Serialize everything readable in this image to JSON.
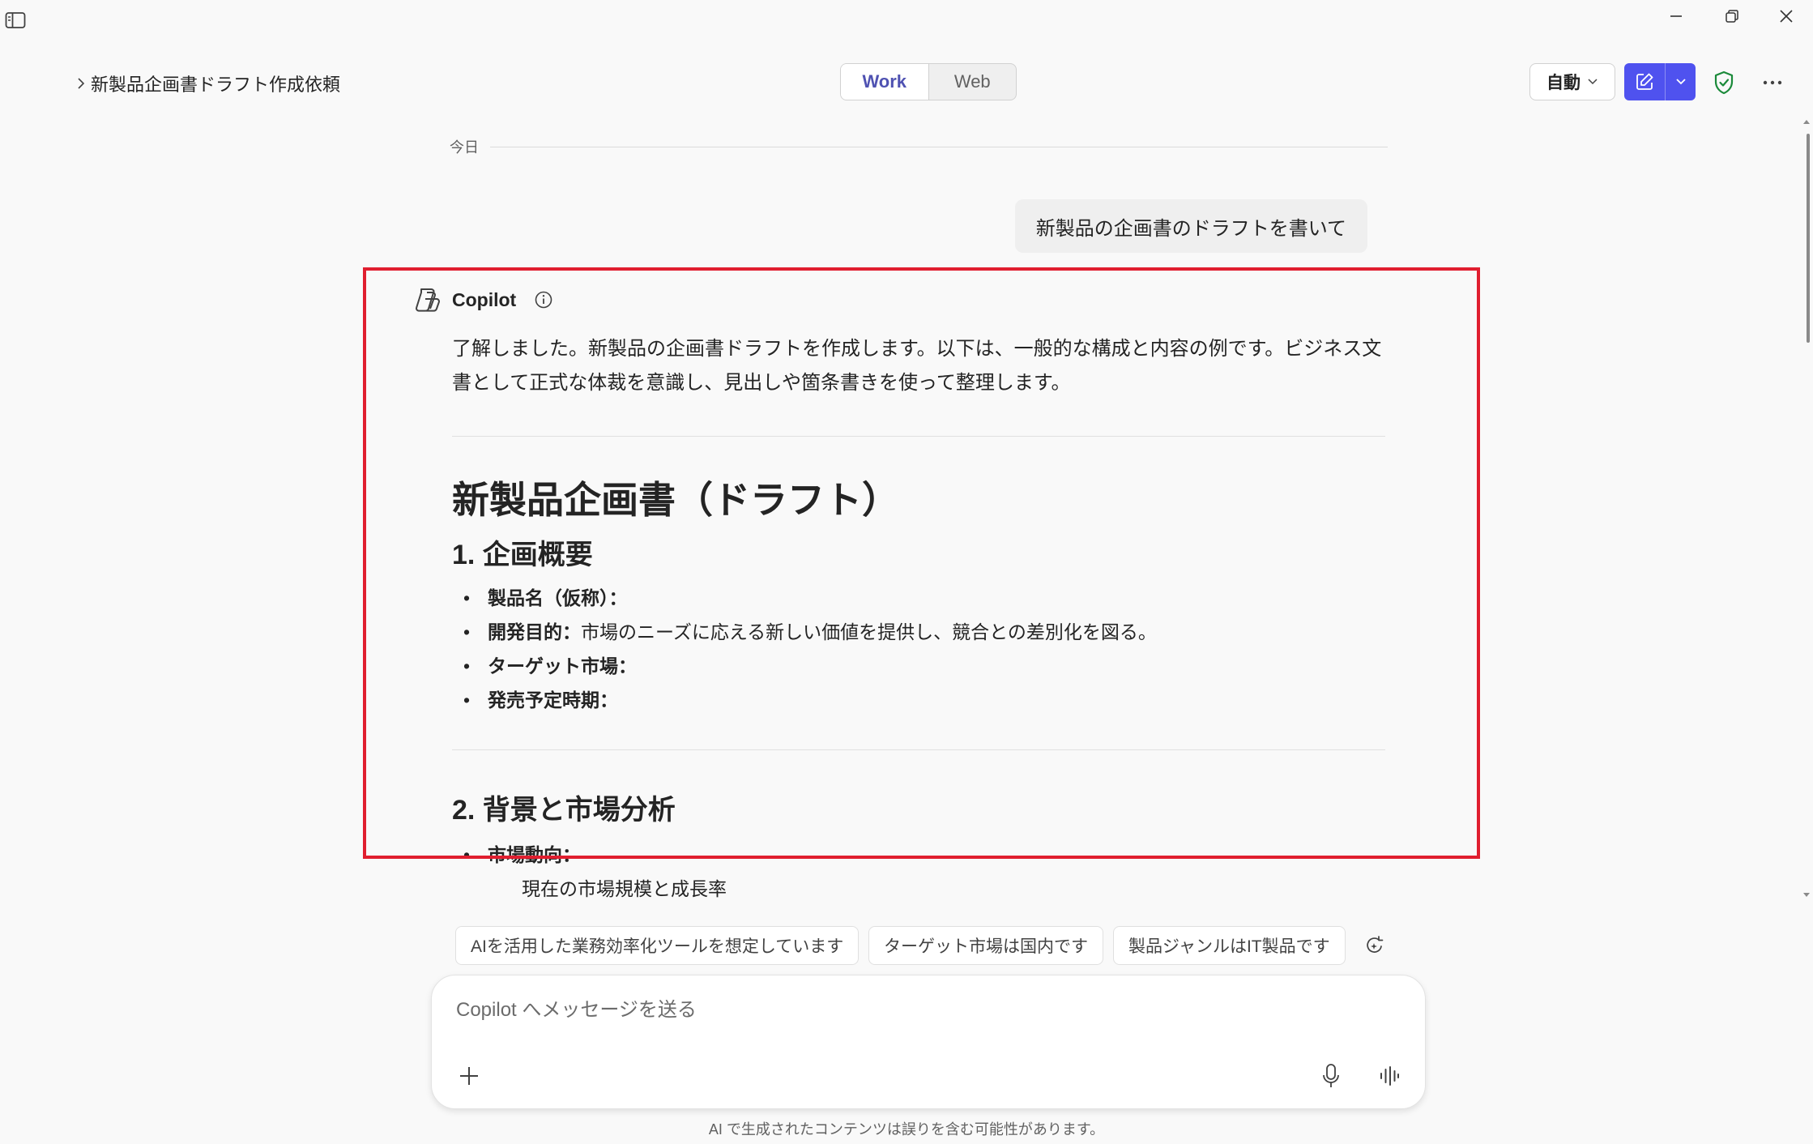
{
  "window": {
    "sidebar_icon": "sidebar-toggle-icon",
    "minimize_icon": "minimize-icon",
    "restore_icon": "restore-icon",
    "close_icon": "close-icon"
  },
  "header": {
    "breadcrumb_title": "新製品企画書ドラフト作成依頼",
    "toggle": {
      "work": "Work",
      "web": "Web"
    },
    "mode_label": "自動",
    "accent_color": "#4f52ef",
    "shield_color": "#1b8a3a"
  },
  "chat": {
    "date_label": "今日",
    "user_message": "新製品の企画書のドラフトを書いて",
    "assistant_name": "Copilot",
    "intro": "了解しました。新製品の企画書ドラフトを作成します。以下は、一般的な構成と内容の例です。ビジネス文書として正式な体裁を意識し、見出しや箇条書きを使って整理します。",
    "doc_title": "新製品企画書（ドラフト）",
    "section1": {
      "heading": "1. 企画概要",
      "items": [
        {
          "label": "製品名（仮称）：",
          "text": ""
        },
        {
          "label": "開発目的：",
          "text": "市場のニーズに応える新しい価値を提供し、競合との差別化を図る。"
        },
        {
          "label": "ターゲット市場：",
          "text": ""
        },
        {
          "label": "発売予定時期：",
          "text": ""
        }
      ]
    },
    "section2": {
      "heading": "2. 背景と市場分析",
      "items": [
        {
          "label": "市場動向：",
          "text": ""
        }
      ],
      "sub_item": "現在の市場規模と成長率"
    }
  },
  "suggestions": [
    "AIを活用した業務効率化ツールを想定しています",
    "ターゲット市場は国内です",
    "製品ジャンルはIT製品です"
  ],
  "composer": {
    "placeholder": "Copilot へメッセージを送る",
    "disclaimer": "AI で生成されたコンテンツは誤りを含む可能性があります。"
  },
  "highlight_color": "#e01e2f"
}
